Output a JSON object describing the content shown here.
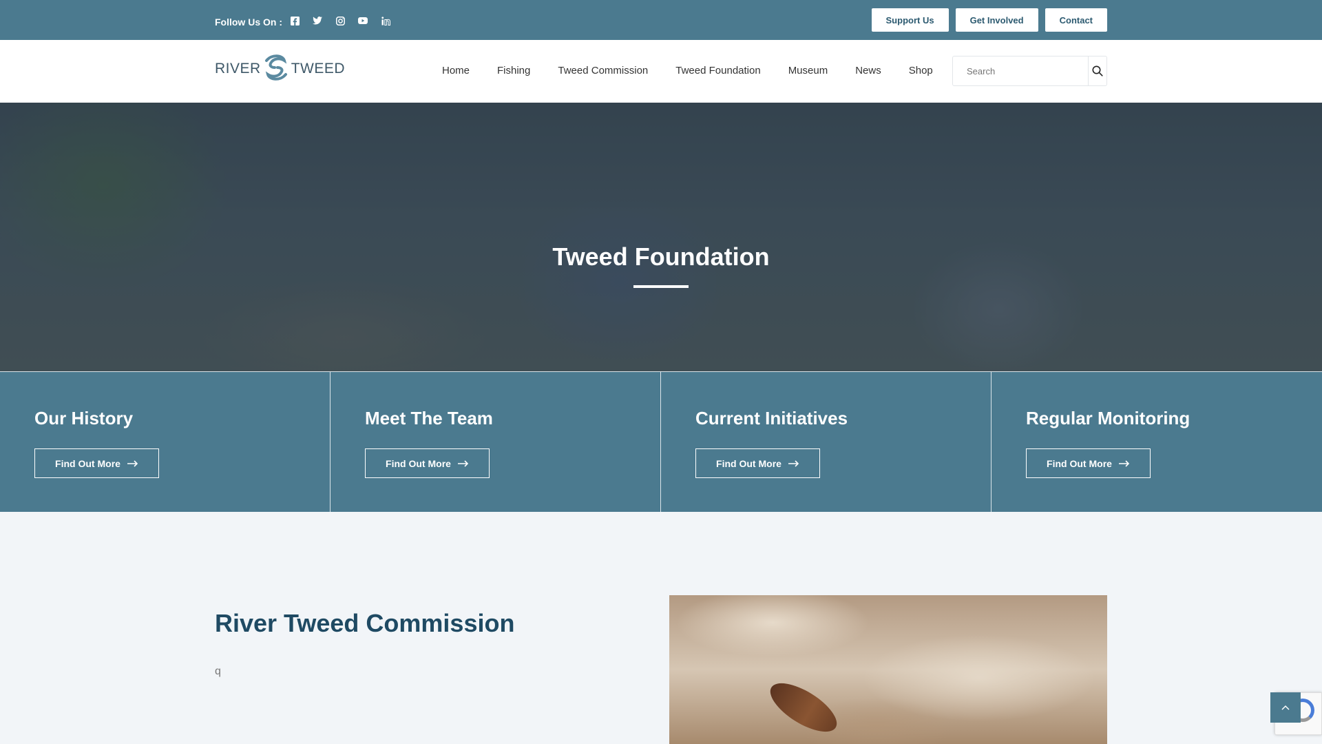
{
  "topbar": {
    "follow_label": "Follow Us On :",
    "socials": [
      "facebook-icon",
      "twitter-icon",
      "instagram-icon",
      "youtube-icon",
      "linkedin-icon"
    ],
    "buttons": [
      "Support Us",
      "Get Involved",
      "Contact"
    ]
  },
  "nav": {
    "logo_left": "RIVER",
    "logo_right": "TWEED",
    "items": [
      "Home",
      "Fishing",
      "Tweed Commission",
      "Tweed Foundation",
      "Museum",
      "News",
      "Shop"
    ],
    "search_placeholder": "Search"
  },
  "hero": {
    "title": "Tweed Foundation"
  },
  "cards": [
    {
      "title": "Our History",
      "button": "Find Out More"
    },
    {
      "title": "Meet The Team",
      "button": "Find Out More"
    },
    {
      "title": "Current Initiatives",
      "button": "Find Out More"
    },
    {
      "title": "Regular Monitoring",
      "button": "Find Out More"
    }
  ],
  "section": {
    "title": "River Tweed Commission",
    "text": "q"
  },
  "colors": {
    "primary": "#4b7a8f",
    "heading": "#1f4a63",
    "background": "#f2f5f8"
  }
}
